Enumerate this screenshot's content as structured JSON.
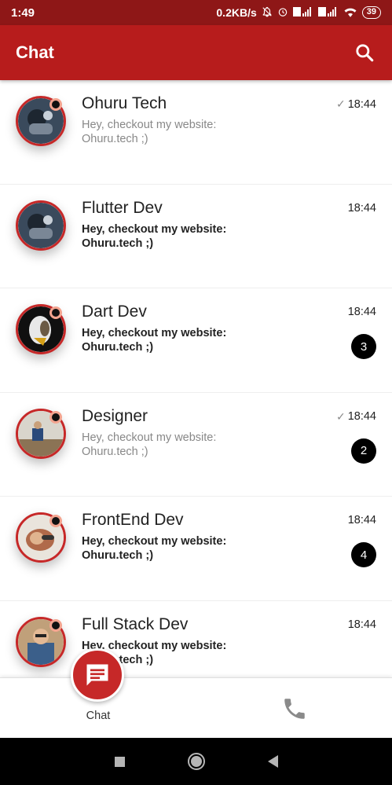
{
  "status_bar": {
    "time": "1:49",
    "speed": "0.2KB/s",
    "battery": "39"
  },
  "app_bar": {
    "title": "Chat"
  },
  "chats": [
    {
      "name": "Ohuru Tech",
      "message": "Hey, checkout my website: Ohuru.tech ;)",
      "time": "18:44",
      "read_check": "✓",
      "unread": false,
      "badge": ""
    },
    {
      "name": "Flutter Dev",
      "message": "Hey, checkout my website: Ohuru.tech ;)",
      "time": "18:44",
      "read_check": "",
      "unread": true,
      "badge": ""
    },
    {
      "name": "Dart Dev",
      "message": "Hey, checkout my website: Ohuru.tech ;)",
      "time": "18:44",
      "read_check": "",
      "unread": true,
      "badge": "3"
    },
    {
      "name": "Designer",
      "message": "Hey, checkout my website: Ohuru.tech ;)",
      "time": "18:44",
      "read_check": "✓",
      "unread": false,
      "badge": "2"
    },
    {
      "name": "FrontEnd Dev",
      "message": "Hey, checkout my website: Ohuru.tech ;)",
      "time": "18:44",
      "read_check": "",
      "unread": true,
      "badge": "4"
    },
    {
      "name": "Full Stack Dev",
      "message": "Hey, checkout my website: Ohuru.tech ;)",
      "time": "18:44",
      "read_check": "",
      "unread": true,
      "badge": ""
    }
  ],
  "bottom_nav": {
    "chat_label": "Chat",
    "chat_icon": "chat-bubble-icon",
    "call_icon": "phone-icon"
  },
  "colors": {
    "primary": "#b71c1c",
    "status_bar": "#8e1717",
    "badge": "#000000"
  }
}
